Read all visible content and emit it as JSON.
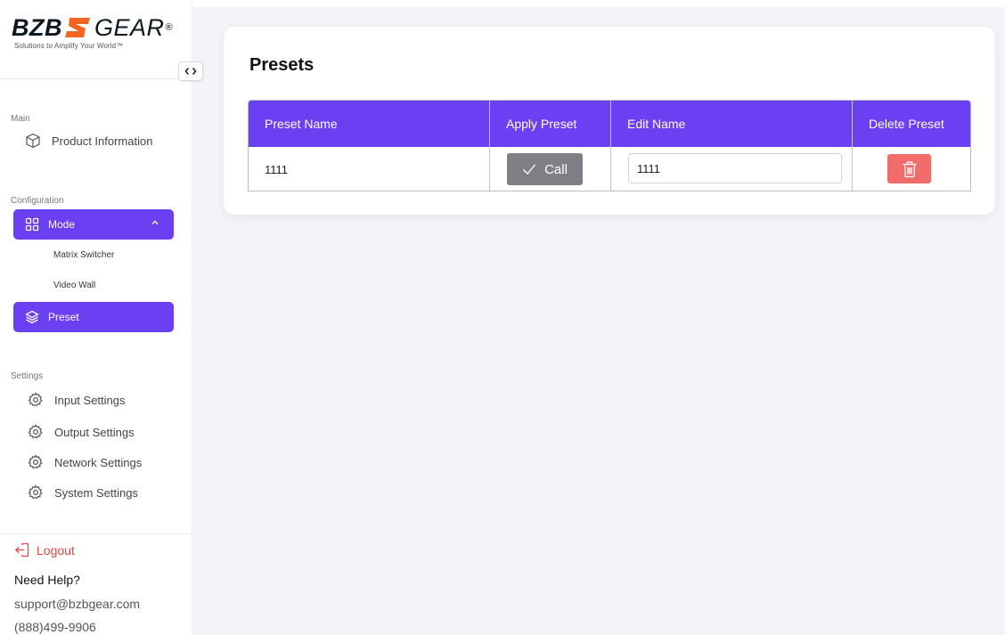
{
  "brand": {
    "name_bold": "BZB",
    "name_light": "GEAR",
    "registered": "®",
    "tagline": "Solutions to Amplify Your World™",
    "logo_color": "#f26522"
  },
  "colors": {
    "accent": "#6b3ff2",
    "danger": "#f26c6c",
    "call_button": "#7f7f86",
    "logout": "#e34848"
  },
  "sidebar": {
    "toggle_icon": "chevrons-left-right-icon",
    "sections": {
      "main": "Main",
      "configuration": "Configuration",
      "settings": "Settings"
    },
    "product_information": {
      "label": "Product Information",
      "icon": "cube-icon"
    },
    "mode": {
      "label": "Mode",
      "icon": "grid-icon",
      "expanded": true
    },
    "mode_items": [
      "Matrix Switcher",
      "Video Wall"
    ],
    "preset": {
      "label": "Preset",
      "icon": "layers-icon",
      "active": true
    },
    "settings_items": [
      {
        "label": "Input Settings",
        "icon": "gear-icon"
      },
      {
        "label": "Output Settings",
        "icon": "gear-icon"
      },
      {
        "label": "Network Settings",
        "icon": "gear-icon"
      },
      {
        "label": "System Settings",
        "icon": "gear-icon"
      }
    ],
    "logout": "Logout",
    "help": {
      "title": "Need Help?",
      "email": "support@bzbgear.com",
      "phone": "(888)499-9906"
    }
  },
  "presets": {
    "title": "Presets",
    "columns": [
      "Preset Name",
      "Apply Preset",
      "Edit Name",
      "Delete Preset"
    ],
    "rows": [
      {
        "name": "1111",
        "apply_label": "Call",
        "edit_value": "1111"
      }
    ]
  }
}
